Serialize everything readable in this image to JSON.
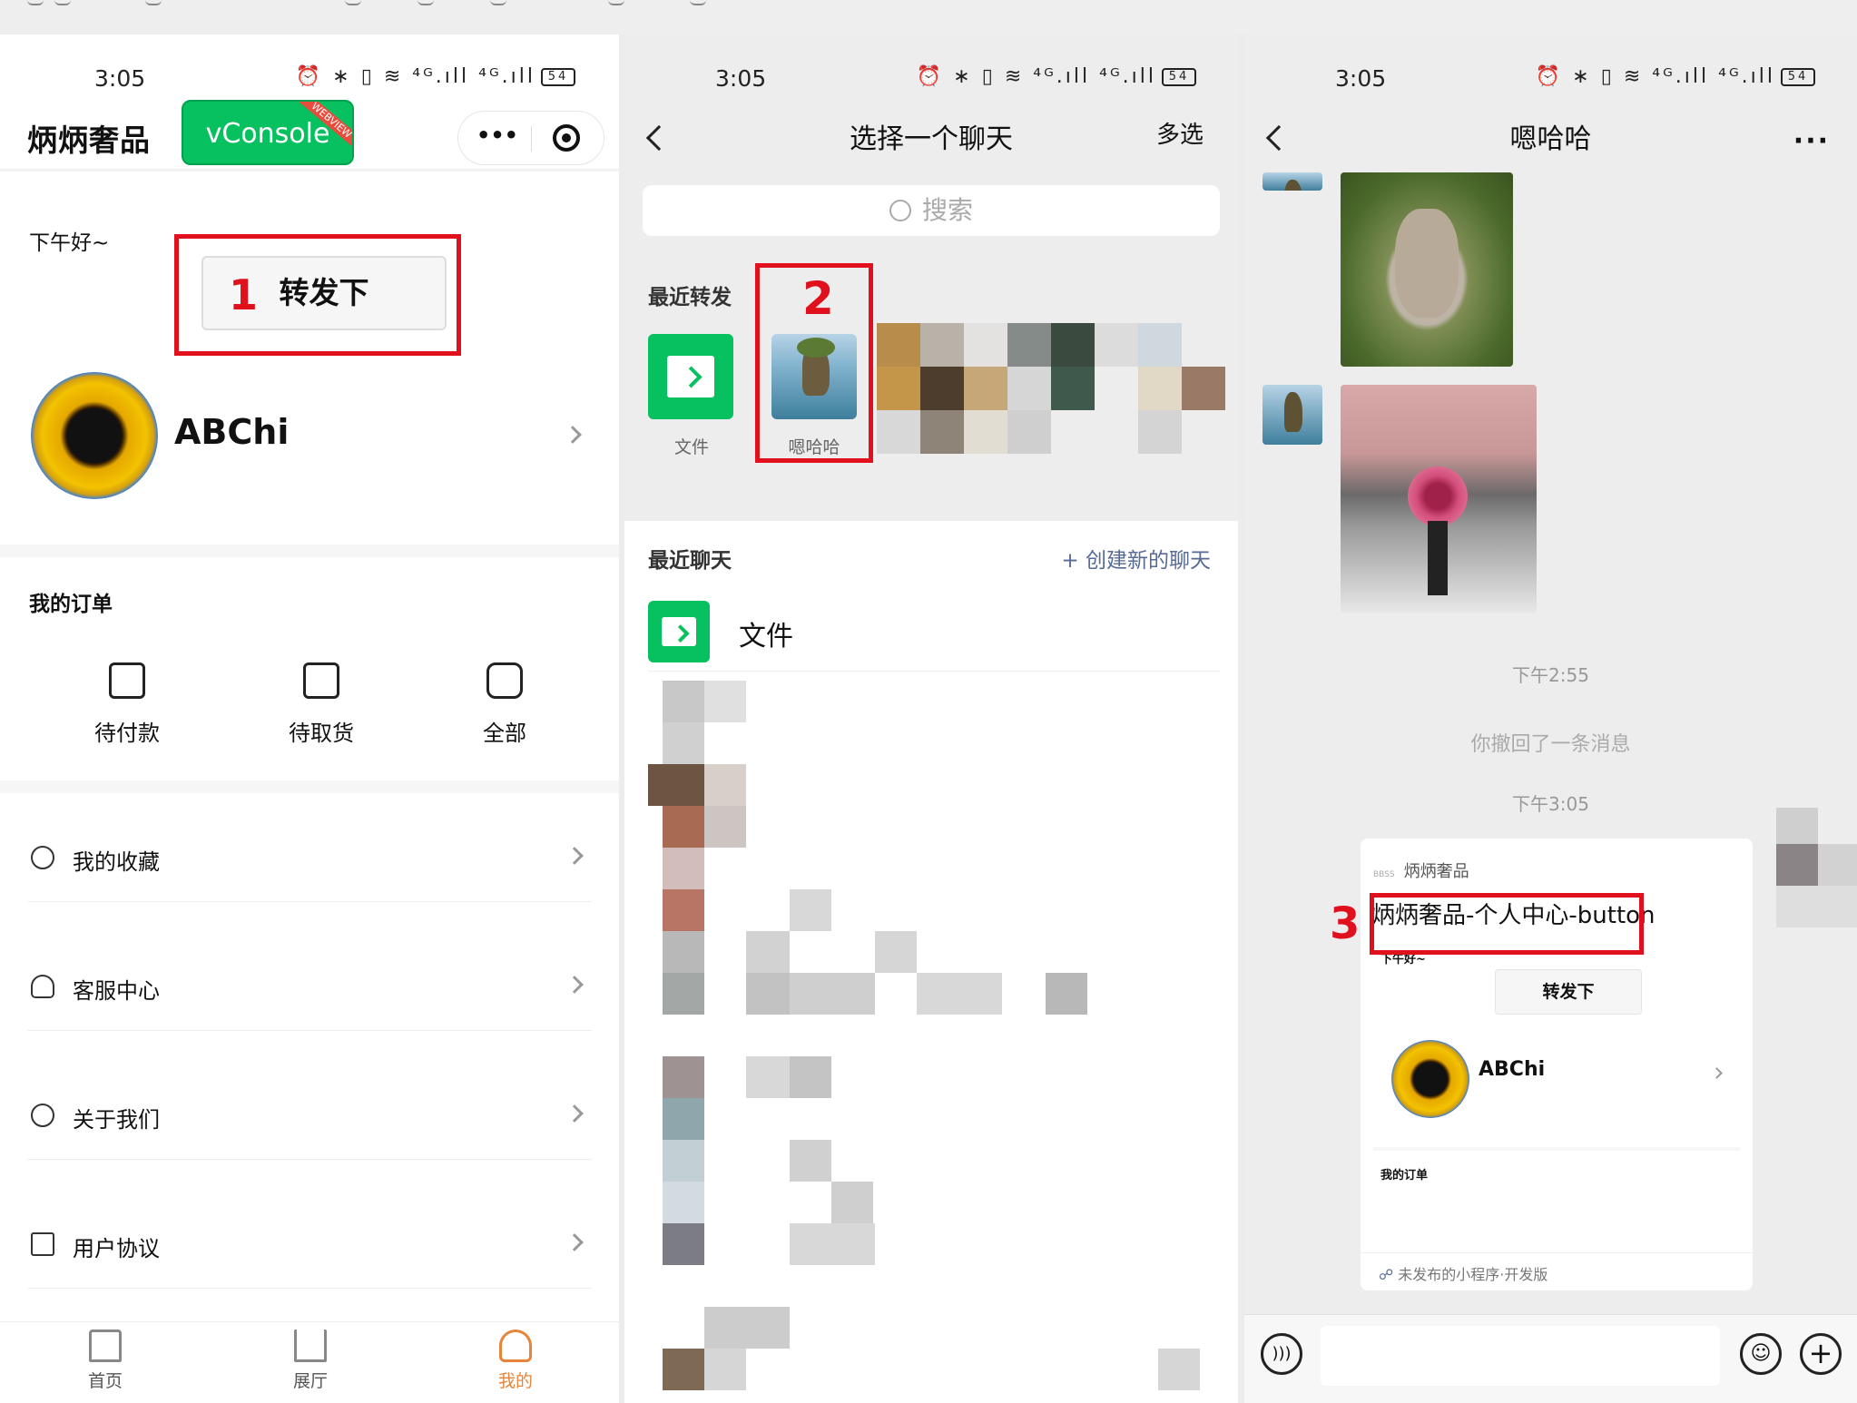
{
  "topbar": {
    "icons": [
      "dot-icon",
      "dot-icon",
      "back-icon",
      "search-icon",
      "search-icon",
      "copy-icon",
      "phone-icon",
      "cut-icon"
    ]
  },
  "status": {
    "time": "3:05",
    "signal": "⏰ ∗ ▯ ≋ ⁴ᴳ.ıll ⁴ᴳ.ıll",
    "battery": "54"
  },
  "panel1": {
    "title": "炳炳奢品",
    "vconsole_label": "vConsole",
    "vconsole_badge": "WEBVIEW",
    "greeting": "下午好~",
    "forward_button": "转发下",
    "marker": "1",
    "username": "ABChi",
    "orders_title": "我的订单",
    "order_items": [
      "待付款",
      "待取货",
      "全部"
    ],
    "menu": [
      {
        "label": "我的收藏",
        "icon": "favorite-icon"
      },
      {
        "label": "客服中心",
        "icon": "headset-icon"
      },
      {
        "label": "关于我们",
        "icon": "planet-icon"
      },
      {
        "label": "用户协议",
        "icon": "document-icon"
      }
    ],
    "tabs": [
      {
        "label": "首页",
        "icon": "home-icon"
      },
      {
        "label": "展厅",
        "icon": "hall-icon"
      },
      {
        "label": "我的",
        "icon": "user-icon",
        "active": true
      }
    ],
    "accent": "#07c160",
    "active_tab_color": "#e8843a"
  },
  "panel2": {
    "title": "选择一个聊天",
    "multi_select": "多选",
    "search_placeholder": "搜索",
    "recent_forward_title": "最近转发",
    "recent_items": [
      "文件",
      "嗯哈哈"
    ],
    "marker": "2",
    "recent_chats_title": "最近聊天",
    "new_chat": "+ 创建新的聊天",
    "file_chat": "文件"
  },
  "panel3": {
    "title": "嗯哈哈",
    "more": "···",
    "time1": "下午2:55",
    "recalled": "你撤回了一条消息",
    "time2": "下午3:05",
    "marker": "3",
    "card": {
      "app_name": "炳炳奢品",
      "title": "炳炳奢品-个人中心-button",
      "greeting": "下午好~",
      "button": "转发下",
      "username": "ABChi",
      "orders": "我的订单",
      "footer": "未发布的小程序·开发版"
    }
  },
  "colors": {
    "red_marker": "#e0101c",
    "link_blue": "#576b95"
  }
}
